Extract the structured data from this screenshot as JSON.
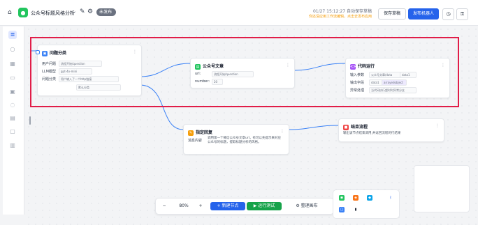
{
  "header": {
    "title": "公众号标题风格分析",
    "badge": "未发布",
    "save_time": "01/27 15:12:27 自动保存草稿",
    "warning": "你还没应用工作流编辑，点击去发布应用",
    "save_draft_label": "保存草稿",
    "publish_label": "发布机器人",
    "icons": [
      "home-icon",
      "chat-logo-icon",
      "edit-icon",
      "settings-icon",
      "history-icon",
      "lock-icon"
    ]
  },
  "sidebar": {
    "items": [
      "workflow-icon",
      "chat-icon",
      "grid-icon",
      "plugin-icon",
      "card-icon",
      "comment-icon",
      "database-icon",
      "file-icon",
      "document-icon"
    ]
  },
  "nodes": {
    "classify": {
      "title": "问题分类",
      "rows": [
        {
          "label": "用户问题",
          "value": "流程开始/question"
        },
        {
          "label": "LLM模型",
          "value": "gpt-4o-mini"
        },
        {
          "label": "问题分类",
          "value": "用户输入了一个http链接"
        }
      ],
      "extra": "默认分类"
    },
    "article": {
      "title": "公众号文章",
      "rows": [
        {
          "label": "url:",
          "value": "流程开始/question"
        },
        {
          "label": "number:",
          "value": "20"
        }
      ]
    },
    "code": {
      "title": "代码运行",
      "rows": [
        {
          "label": "输入参数",
          "value": "公众号文章/data",
          "extra": "data1"
        },
        {
          "label": "输出字段",
          "value": "data1",
          "extra": "arrayedobject"
        },
        {
          "label": "异常处理",
          "value": "当代码执行超时时异常分支"
        }
      ]
    },
    "reply": {
      "title": "指定回复",
      "label": "消息内容",
      "text": "调用第一个微信公众号文章url，有可以先提示来对应公众号的标题，提取标题分析的风格。"
    },
    "end": {
      "title": "结束流程",
      "text": "输出该节点结束调用,并返回流程的行结果"
    }
  },
  "toolbar": {
    "zoom_out": "−",
    "zoom": "80%",
    "zoom_in": "+",
    "new_node": "+ 新建节点",
    "run_test": "▶ 运行测试",
    "arrange": "整理画布"
  },
  "colors": {
    "accent": "#2563eb",
    "run": "#16a34a",
    "selection": "#e11d48",
    "edge": "#3b82f6"
  }
}
